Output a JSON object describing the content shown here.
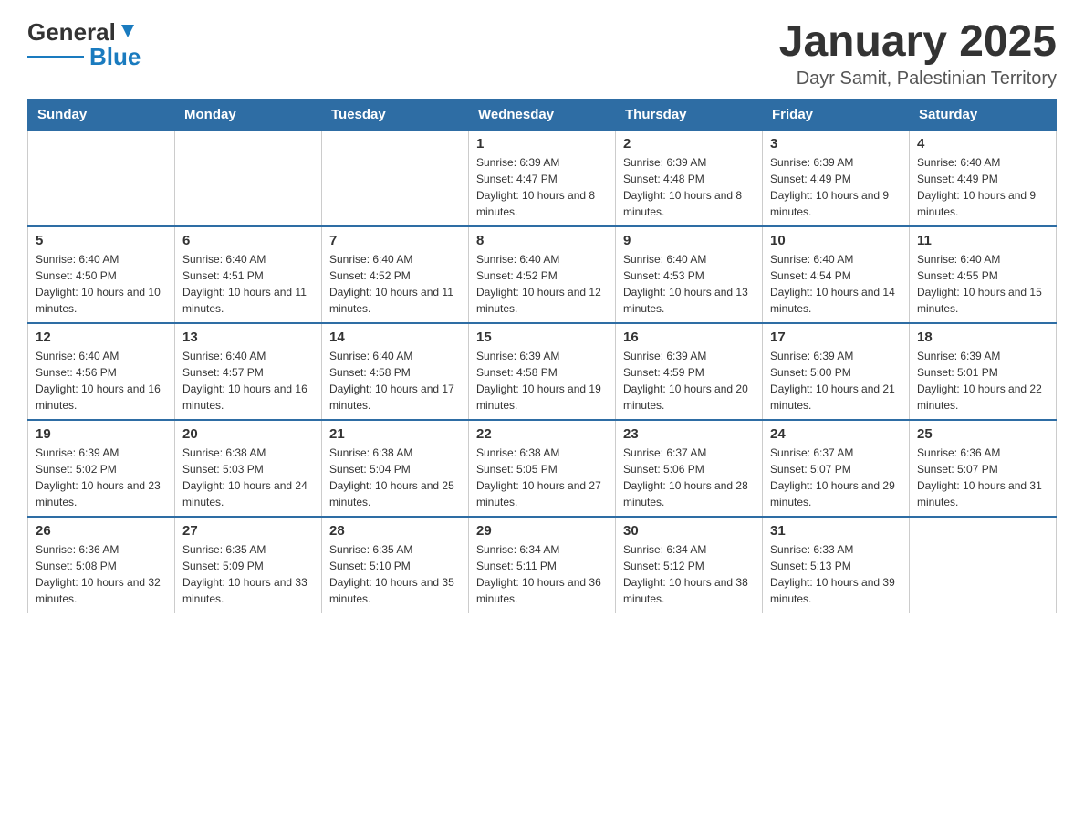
{
  "header": {
    "logo_general": "General",
    "logo_blue": "Blue",
    "month_title": "January 2025",
    "location": "Dayr Samit, Palestinian Territory"
  },
  "days_of_week": [
    "Sunday",
    "Monday",
    "Tuesday",
    "Wednesday",
    "Thursday",
    "Friday",
    "Saturday"
  ],
  "weeks": [
    [
      {
        "day": "",
        "info": ""
      },
      {
        "day": "",
        "info": ""
      },
      {
        "day": "",
        "info": ""
      },
      {
        "day": "1",
        "info": "Sunrise: 6:39 AM\nSunset: 4:47 PM\nDaylight: 10 hours and 8 minutes."
      },
      {
        "day": "2",
        "info": "Sunrise: 6:39 AM\nSunset: 4:48 PM\nDaylight: 10 hours and 8 minutes."
      },
      {
        "day": "3",
        "info": "Sunrise: 6:39 AM\nSunset: 4:49 PM\nDaylight: 10 hours and 9 minutes."
      },
      {
        "day": "4",
        "info": "Sunrise: 6:40 AM\nSunset: 4:49 PM\nDaylight: 10 hours and 9 minutes."
      }
    ],
    [
      {
        "day": "5",
        "info": "Sunrise: 6:40 AM\nSunset: 4:50 PM\nDaylight: 10 hours and 10 minutes."
      },
      {
        "day": "6",
        "info": "Sunrise: 6:40 AM\nSunset: 4:51 PM\nDaylight: 10 hours and 11 minutes."
      },
      {
        "day": "7",
        "info": "Sunrise: 6:40 AM\nSunset: 4:52 PM\nDaylight: 10 hours and 11 minutes."
      },
      {
        "day": "8",
        "info": "Sunrise: 6:40 AM\nSunset: 4:52 PM\nDaylight: 10 hours and 12 minutes."
      },
      {
        "day": "9",
        "info": "Sunrise: 6:40 AM\nSunset: 4:53 PM\nDaylight: 10 hours and 13 minutes."
      },
      {
        "day": "10",
        "info": "Sunrise: 6:40 AM\nSunset: 4:54 PM\nDaylight: 10 hours and 14 minutes."
      },
      {
        "day": "11",
        "info": "Sunrise: 6:40 AM\nSunset: 4:55 PM\nDaylight: 10 hours and 15 minutes."
      }
    ],
    [
      {
        "day": "12",
        "info": "Sunrise: 6:40 AM\nSunset: 4:56 PM\nDaylight: 10 hours and 16 minutes."
      },
      {
        "day": "13",
        "info": "Sunrise: 6:40 AM\nSunset: 4:57 PM\nDaylight: 10 hours and 16 minutes."
      },
      {
        "day": "14",
        "info": "Sunrise: 6:40 AM\nSunset: 4:58 PM\nDaylight: 10 hours and 17 minutes."
      },
      {
        "day": "15",
        "info": "Sunrise: 6:39 AM\nSunset: 4:58 PM\nDaylight: 10 hours and 19 minutes."
      },
      {
        "day": "16",
        "info": "Sunrise: 6:39 AM\nSunset: 4:59 PM\nDaylight: 10 hours and 20 minutes."
      },
      {
        "day": "17",
        "info": "Sunrise: 6:39 AM\nSunset: 5:00 PM\nDaylight: 10 hours and 21 minutes."
      },
      {
        "day": "18",
        "info": "Sunrise: 6:39 AM\nSunset: 5:01 PM\nDaylight: 10 hours and 22 minutes."
      }
    ],
    [
      {
        "day": "19",
        "info": "Sunrise: 6:39 AM\nSunset: 5:02 PM\nDaylight: 10 hours and 23 minutes."
      },
      {
        "day": "20",
        "info": "Sunrise: 6:38 AM\nSunset: 5:03 PM\nDaylight: 10 hours and 24 minutes."
      },
      {
        "day": "21",
        "info": "Sunrise: 6:38 AM\nSunset: 5:04 PM\nDaylight: 10 hours and 25 minutes."
      },
      {
        "day": "22",
        "info": "Sunrise: 6:38 AM\nSunset: 5:05 PM\nDaylight: 10 hours and 27 minutes."
      },
      {
        "day": "23",
        "info": "Sunrise: 6:37 AM\nSunset: 5:06 PM\nDaylight: 10 hours and 28 minutes."
      },
      {
        "day": "24",
        "info": "Sunrise: 6:37 AM\nSunset: 5:07 PM\nDaylight: 10 hours and 29 minutes."
      },
      {
        "day": "25",
        "info": "Sunrise: 6:36 AM\nSunset: 5:07 PM\nDaylight: 10 hours and 31 minutes."
      }
    ],
    [
      {
        "day": "26",
        "info": "Sunrise: 6:36 AM\nSunset: 5:08 PM\nDaylight: 10 hours and 32 minutes."
      },
      {
        "day": "27",
        "info": "Sunrise: 6:35 AM\nSunset: 5:09 PM\nDaylight: 10 hours and 33 minutes."
      },
      {
        "day": "28",
        "info": "Sunrise: 6:35 AM\nSunset: 5:10 PM\nDaylight: 10 hours and 35 minutes."
      },
      {
        "day": "29",
        "info": "Sunrise: 6:34 AM\nSunset: 5:11 PM\nDaylight: 10 hours and 36 minutes."
      },
      {
        "day": "30",
        "info": "Sunrise: 6:34 AM\nSunset: 5:12 PM\nDaylight: 10 hours and 38 minutes."
      },
      {
        "day": "31",
        "info": "Sunrise: 6:33 AM\nSunset: 5:13 PM\nDaylight: 10 hours and 39 minutes."
      },
      {
        "day": "",
        "info": ""
      }
    ]
  ]
}
